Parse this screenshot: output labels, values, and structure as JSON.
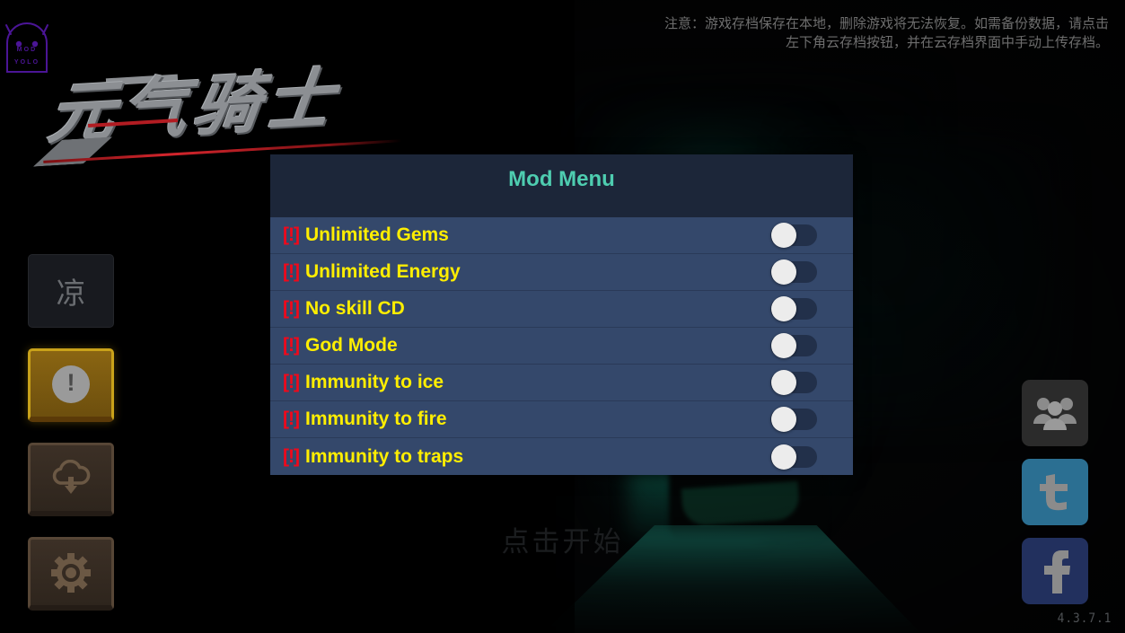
{
  "window": {
    "version_label": "4.3.7.1",
    "start_prompt": "点击开始"
  },
  "watermark": {
    "line1": "MOD",
    "line2": "YOLO",
    "color": "#4b1596",
    "icon": "android-robot-head-icon"
  },
  "logo": {
    "title": "元气骑士",
    "accent_color": "#b21c22",
    "text_color": "#8c8f93"
  },
  "warning": {
    "text": "注意：游戏存档保存在本地，删除游戏将无法恢复。如需备份数据，请点击左下角云存档按钮，并在云存档界面中手动上传存档。",
    "color": "#6e6e6e"
  },
  "sidebar": {
    "items": [
      {
        "name": "language-button",
        "glyph": "凉",
        "style": "dark",
        "icon": "text-glyph-icon"
      },
      {
        "name": "notice-button",
        "glyph": "!",
        "style": "gold",
        "icon": "exclamation-circle-icon"
      },
      {
        "name": "cloud-save-button",
        "glyph": "",
        "style": "brown",
        "icon": "cloud-download-icon"
      },
      {
        "name": "settings-button",
        "glyph": "",
        "style": "brown",
        "icon": "gear-icon"
      }
    ]
  },
  "social": {
    "items": [
      {
        "name": "community-button",
        "icon": "people-group-icon",
        "color": "#2b2b2b"
      },
      {
        "name": "twitter-button",
        "icon": "twitter-icon",
        "color": "#2b6f92"
      },
      {
        "name": "facebook-button",
        "icon": "facebook-icon",
        "color": "#22305e"
      }
    ]
  },
  "mod_menu": {
    "title": "Mod Menu",
    "title_color": "#4ecdb0",
    "header_bg": "#1c2639",
    "row_bg": "#34486b",
    "label_color": "#ffee00",
    "bang_color": "#f2081a",
    "bang_text": "[!]",
    "items": [
      {
        "label": "Unlimited Gems",
        "enabled": false
      },
      {
        "label": "Unlimited Energy",
        "enabled": false
      },
      {
        "label": "No skill CD",
        "enabled": false
      },
      {
        "label": "God Mode",
        "enabled": false
      },
      {
        "label": "Immunity to ice",
        "enabled": false
      },
      {
        "label": "Immunity to fire",
        "enabled": false
      },
      {
        "label": "Immunity to traps",
        "enabled": false
      }
    ]
  }
}
